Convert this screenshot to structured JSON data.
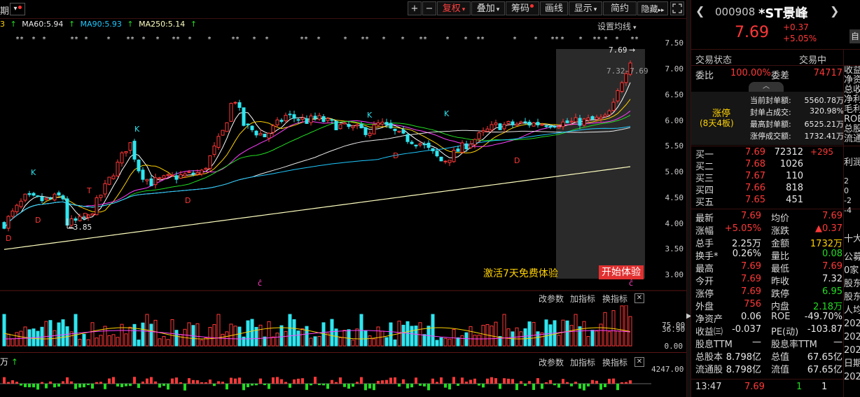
{
  "topbar": {
    "period_label": "期",
    "btn_plus": "+",
    "btn_minus": "−",
    "fuquan": "复权",
    "diejia": "叠加",
    "choumai": "筹码",
    "huaxian": "画线",
    "xianshi": "显示",
    "jianjie": "简约",
    "yincang": "隐藏",
    "double_right": "▸▸"
  },
  "ma": {
    "ma_prefix": "3",
    "ma60": "MA60:5.94",
    "ma90": "MA90:5.93",
    "ma250": "MA250:5.14",
    "settings": "设置均线",
    "colors": {
      "ma60": "#e8e8e8",
      "ma90": "#1ec8ff",
      "ma250": "#ffffc0"
    }
  },
  "chart": {
    "y_ticks": [
      "7.50",
      "7.00",
      "6.50",
      "6.00",
      "5.50",
      "5.00",
      "4.50",
      "4.00",
      "3.50",
      "3.00"
    ],
    "top_price": "7.69",
    "range_label": "7.32-7.69",
    "low_label": "3.85",
    "promo_text": "激活7天免费体验",
    "promo_button": "开始体验",
    "marker_k": "K",
    "marker_d": "D",
    "marker_c": "ĉ",
    "marker_t": "T"
  },
  "chart_data": {
    "type": "candlestick",
    "y_range": [
      2.85,
      7.75
    ],
    "ma_values": {
      "MA60": 5.94,
      "MA90": 5.93,
      "MA250": 5.14
    },
    "last_close": 7.69,
    "marked_low": 3.85
  },
  "volume": {
    "change_params": "改参数",
    "add_indicator": "加指标",
    "switch_indicator": "换指标",
    "ticks": [
      "75.00",
      "36.90",
      "0.00"
    ]
  },
  "sub2": {
    "label": "万",
    "change_params": "改参数",
    "add_indicator": "加指标",
    "switch_indicator": "换指标",
    "tick": "4247.00"
  },
  "stock": {
    "code": "000908",
    "name": "*ST景峰",
    "price": "7.69",
    "change": "+0.37",
    "change_pct": "+5.05%",
    "side_btn": "自"
  },
  "status": {
    "label": "交易状态",
    "value": "交易中",
    "weibi_label": "委比",
    "weibi_value": "100.00%",
    "weicha_label": "委差",
    "weicha_value": "74717"
  },
  "limit": {
    "title": "涨停",
    "sub": "(8天4板)",
    "rows": [
      {
        "k": "当前封单额:",
        "v": "5560.78万"
      },
      {
        "k": "封单占成交:",
        "v": "320.98%"
      },
      {
        "k": "最高封单额:",
        "v": "6525.21万"
      },
      {
        "k": "涨停成交额:",
        "v": "1732.41万"
      }
    ]
  },
  "book": [
    {
      "k": "买一",
      "p": "7.69",
      "q": "72312",
      "d": "+295"
    },
    {
      "k": "买二",
      "p": "7.68",
      "q": "1026",
      "d": ""
    },
    {
      "k": "买三",
      "p": "7.67",
      "q": "110",
      "d": ""
    },
    {
      "k": "买四",
      "p": "7.66",
      "q": "818",
      "d": ""
    },
    {
      "k": "买五",
      "p": "7.65",
      "q": "451",
      "d": ""
    }
  ],
  "stats": [
    {
      "k": "最新",
      "v": "7.69",
      "vc": "red",
      "k2": "均价",
      "v2": "7.69",
      "v2c": "red"
    },
    {
      "k": "涨幅",
      "v": "+5.05%",
      "vc": "red",
      "k2": "涨跌",
      "v2": "▲0.37",
      "v2c": "red"
    },
    {
      "k": "总手",
      "v": "2.25万",
      "vc": "white",
      "k2": "金额",
      "v2": "1732万",
      "v2c": "yellow"
    },
    {
      "k": "换手*",
      "v": "0.26%",
      "vc": "white",
      "k2": "量比",
      "v2": "0.08",
      "v2c": "green"
    },
    {
      "k": "最高",
      "v": "7.69",
      "vc": "red",
      "k2": "最低",
      "v2": "7.69",
      "v2c": "red"
    },
    {
      "k": "今开",
      "v": "7.69",
      "vc": "red",
      "k2": "昨收",
      "v2": "7.32",
      "v2c": "white"
    },
    {
      "k": "涨停",
      "v": "7.69",
      "vc": "red",
      "k2": "跌停",
      "v2": "6.95",
      "v2c": "green"
    },
    {
      "k": "外盘",
      "v": "756",
      "vc": "red",
      "k2": "内盘",
      "v2": "2.18万",
      "v2c": "green"
    },
    {
      "k": "净资产",
      "v": "0.06",
      "vc": "white",
      "k2": "ROE",
      "v2": "-49.70%",
      "v2c": "white"
    },
    {
      "k": "收益㈢",
      "v": "-0.037",
      "vc": "white",
      "k2": "PE(动)",
      "v2": "-103.87",
      "v2c": "white"
    },
    {
      "k": "股息TTM",
      "v": "—",
      "vc": "white",
      "k2": "股息率TTM",
      "v2": "—",
      "v2c": "white"
    },
    {
      "k": "总股本",
      "v": "8.798亿",
      "vc": "white",
      "k2": "总值",
      "v2": "67.65亿",
      "v2c": "white"
    },
    {
      "k": "流通股",
      "v": "8.798亿",
      "vc": "white",
      "k2": "流值",
      "v2": "67.65亿",
      "v2c": "white"
    }
  ],
  "tick_row": {
    "time": "13:47",
    "price": "7.69",
    "vol": "1",
    "n": "1"
  },
  "edge": {
    "col1": [
      "收益",
      "净资",
      "总收",
      "净利",
      "毛利",
      "ROE",
      "总股",
      "流通"
    ],
    "col2": [
      "利润"
    ],
    "col3": [
      "2",
      "0",
      "-2",
      "-4"
    ],
    "col4": [
      "十大"
    ],
    "col5": [
      "公募",
      "0家",
      "股东",
      "股东",
      "人均",
      "202",
      "202",
      "202",
      "日期",
      "202"
    ]
  }
}
